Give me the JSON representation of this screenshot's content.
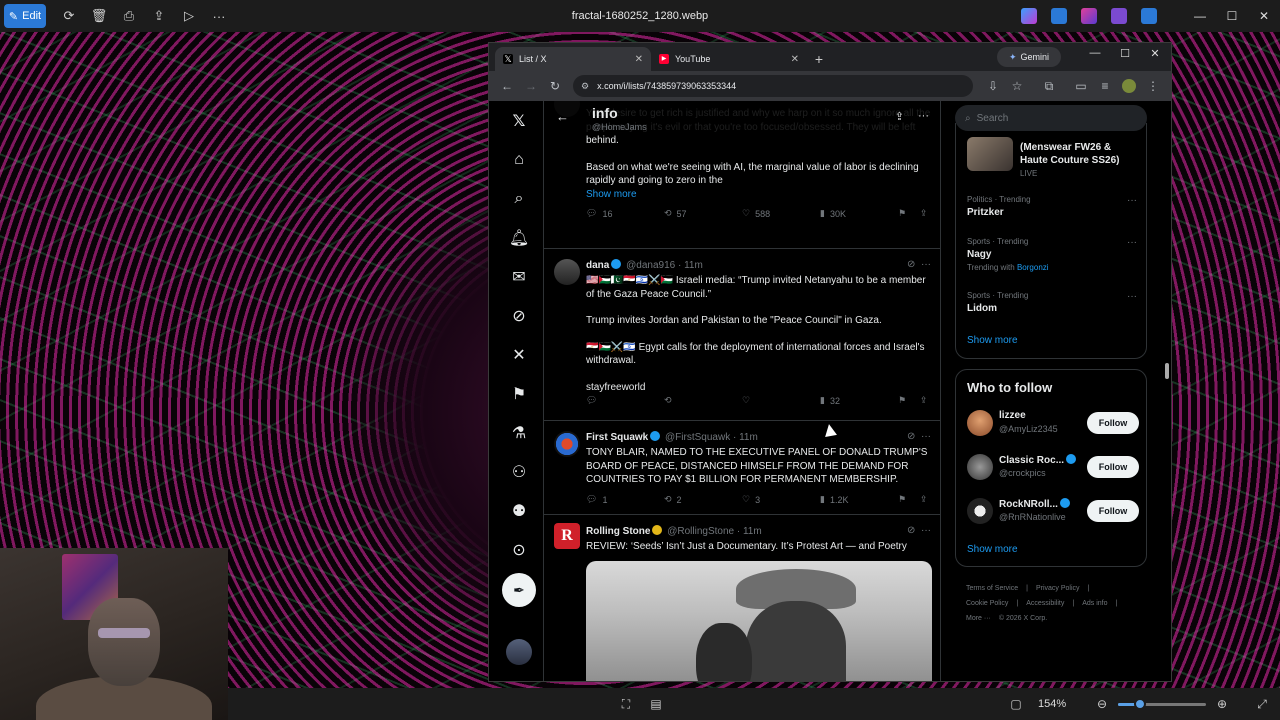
{
  "viewer": {
    "edit_label": "Edit",
    "file_name": "fractal-1680252_1280.webp",
    "zoom_label": "154%",
    "zoom_fraction": 0.25
  },
  "browser": {
    "tabs": [
      {
        "label": "List / X",
        "favicon": "x-logo"
      },
      {
        "label": "YouTube",
        "favicon": "youtube-logo"
      }
    ],
    "gemini_label": "Gemini",
    "url": "x.com/i/lists/743859739063353344"
  },
  "timeline": {
    "title": "info",
    "subtitle": "@HomeJams",
    "tweets": [
      {
        "text_lines": [
          "Your desire to get rich is justified and why we harp on it so much ignore all the people saying it's evil or that you're too focused/obsessed. They will be left behind.",
          "Based on what we're seeing with AI, the marginal value of labor is declining rapidly and going to zero in the"
        ],
        "show_more": "Show more",
        "replies": "16",
        "reposts": "57",
        "likes": "588",
        "views": "30K"
      },
      {
        "name": "dana",
        "handle": "@dana916",
        "time": "· 11m",
        "paragraphs": [
          "🇺🇸🇵🇸🇵🇰🇪🇬🇮🇱⚔️🇵🇸 Israeli media: “Trump invited Netanyahu to be a member of the Gaza Peace Council.”",
          "Trump invites Jordan and Pakistan to the \"Peace Council\" in Gaza.",
          "🇪🇬🇵🇸⚔️🇮🇱 Egypt calls for the deployment of international forces and Israel's withdrawal.",
          "stayfreeworld"
        ],
        "replies": "",
        "reposts": "",
        "likes": "",
        "views": "32"
      },
      {
        "name": "First Squawk",
        "handle": "@FirstSquawk",
        "time": "· 11m",
        "paragraphs": [
          "TONY BLAIR, NAMED TO THE EXECUTIVE PANEL OF DONALD TRUMP'S BOARD OF PEACE, DISTANCED HIMSELF FROM THE DEMAND FOR COUNTRIES TO PAY $1 BILLION FOR PERMANENT MEMBERSHIP."
        ],
        "replies": "1",
        "reposts": "2",
        "likes": "3",
        "views": "1.2K"
      },
      {
        "name": "Rolling Stone",
        "handle": "@RollingStone",
        "time": "· 11m",
        "paragraphs": [
          "REVIEW: ‘Seeds’ Isn’t Just a Documentary. It’s Protest Art — and Poetry"
        ]
      }
    ]
  },
  "sidebar": {
    "search_placeholder": "Search",
    "live_event": {
      "title": "(Menswear FW26 & Haute Couture SS26)",
      "status": "LIVE"
    },
    "trends": [
      {
        "category": "Politics · Trending",
        "name": "Pritzker",
        "extra": ""
      },
      {
        "category": "Sports · Trending",
        "name": "Nagy",
        "extra_prefix": "Trending with",
        "extra_link": "Borgonzi"
      },
      {
        "category": "Sports · Trending",
        "name": "Lidom",
        "extra": ""
      }
    ],
    "show_more": "Show more",
    "who_to_follow_title": "Who to follow",
    "follow_label": "Follow",
    "suggestions": [
      {
        "name": "lizzee",
        "handle": "@AmyLiz2345"
      },
      {
        "name": "Classic Roc...",
        "handle": "@crockpics"
      },
      {
        "name": "RockNRoll...",
        "handle": "@RnRNationlive"
      }
    ],
    "show_more_2": "Show more",
    "footer": [
      "Terms of Service",
      "|",
      "Privacy Policy",
      "|",
      "Cookie Policy",
      "|",
      "Accessibility",
      "|",
      "Ads info",
      "|",
      "More ···",
      "© 2026 X Corp."
    ]
  }
}
